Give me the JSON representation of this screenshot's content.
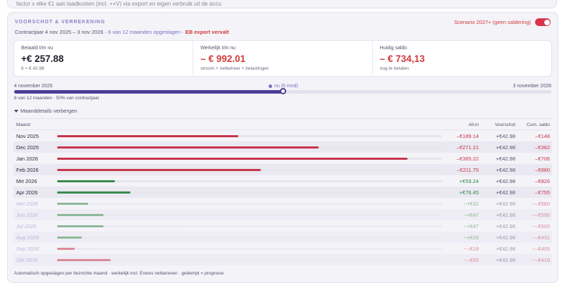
{
  "top_fragment": "factor x elke €1 aan laadkosten (incl. ++V) via export en eigen verbruik uit de accu",
  "card": {
    "title": "VOORSCHOT & VERREKENING",
    "subtitle_period": "Contractjaar 4 nov 2025 – 3 nov 2026",
    "subtitle_sep1": " · ",
    "subtitle_saved": "6 van 12 maanden opgeslagen",
    "subtitle_sep2": " · ",
    "subtitle_warning": "EB export vervalt",
    "scenario_label": "Scenario 2027+ (geen saldering)",
    "scenario_on": true
  },
  "summary": [
    {
      "label": "Betaald t/m nu",
      "value": "+€ 257.88",
      "note": "6 × € 42.98",
      "negative": false
    },
    {
      "label": "Werkelijk t/m nu",
      "value": "– € 992.01",
      "note": "stroom + netbeheer + belastingen",
      "negative": true
    },
    {
      "label": "Huidig saldo",
      "value": "– € 734,13",
      "note": "nog te betalen",
      "negative": true
    }
  ],
  "timeline": {
    "start": "4 november 2025",
    "end": "3 november 2026",
    "now_label": "nu (6 mnd)",
    "progress": 0.5,
    "caption": "6 van 12 maanden · 50% van contractjaar"
  },
  "details_toggle": "Maanddetails verbergen",
  "table": {
    "headers": {
      "month": "Maand",
      "allin": "All-in",
      "voorschot": "Voorschot",
      "cum": "Cum. saldo"
    },
    "rows": [
      {
        "month": "Nov 2025",
        "allin": "–€189.14",
        "voorschot": "+€42.98",
        "cum": "–€148",
        "bar": 0.47,
        "kind": "cost",
        "projected": false
      },
      {
        "month": "Dec 2025",
        "allin": "–€271.21",
        "voorschot": "+€42.98",
        "cum": "–€382",
        "bar": 0.68,
        "kind": "cost",
        "projected": false
      },
      {
        "month": "Jan 2026",
        "allin": "–€365.22",
        "voorschot": "+€42.98",
        "cum": "–€706",
        "bar": 0.91,
        "kind": "cost",
        "projected": false
      },
      {
        "month": "Feb 2026",
        "allin": "–€211.75",
        "voorschot": "+€42.98",
        "cum": "–€880",
        "bar": 0.53,
        "kind": "cost",
        "projected": false
      },
      {
        "month": "Mrt 2026",
        "allin": "+€59.24",
        "voorschot": "+€42.98",
        "cum": "–€826",
        "bar": 0.15,
        "kind": "gain",
        "projected": false
      },
      {
        "month": "Apr 2026",
        "allin": "+€76.45",
        "voorschot": "+€42.98",
        "cum": "–€755",
        "bar": 0.19,
        "kind": "gain",
        "projected": false
      },
      {
        "month": "Mei 2026",
        "allin": "~+€32",
        "voorschot": "+€42.98",
        "cum": "~–€680",
        "bar": 0.08,
        "kind": "gain",
        "projected": true
      },
      {
        "month": "Jun 2026",
        "allin": "~+€47",
        "voorschot": "+€42.98",
        "cum": "~–€590",
        "bar": 0.12,
        "kind": "gain",
        "projected": true
      },
      {
        "month": "Jul 2026",
        "allin": "~+€47",
        "voorschot": "+€42.98",
        "cum": "~–€500",
        "bar": 0.12,
        "kind": "gain",
        "projected": true
      },
      {
        "month": "Aug 2026",
        "allin": "~+€26",
        "voorschot": "+€42.98",
        "cum": "~–€431",
        "bar": 0.065,
        "kind": "gain",
        "projected": true
      },
      {
        "month": "Sep 2026",
        "allin": "~–€18",
        "voorschot": "+€42.98",
        "cum": "~–€406",
        "bar": 0.045,
        "kind": "cost",
        "projected": true
      },
      {
        "month": "Okt 2026",
        "allin": "~–€55",
        "voorschot": "+€42.98",
        "cum": "~–€418",
        "bar": 0.14,
        "kind": "cost",
        "projected": true
      }
    ]
  },
  "footer_note": "Automatisch opgeslagen per bezochte maand · werkelijk incl. Enexis nettarieven · gedempt = prognose",
  "colors": {
    "cost": "#c7364b",
    "gain": "#3a8a4e",
    "cost_text": "#c7364b",
    "gain_text": "#2f8a44",
    "accent": "#7a6fc6",
    "progress": "#4a3f96"
  }
}
